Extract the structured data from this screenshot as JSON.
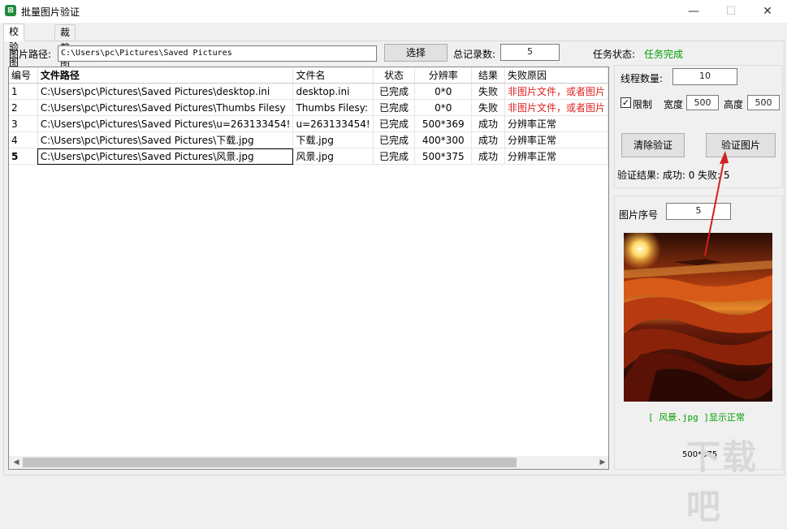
{
  "window": {
    "title": "批量图片验证",
    "minimize": "—",
    "maximize": "☐",
    "close": "✕"
  },
  "tabs": [
    {
      "label": "校验图片"
    },
    {
      "label": "裁剪图片"
    }
  ],
  "toolbar": {
    "path_label": "图片路径:",
    "path_value": "C:\\Users\\pc\\Pictures\\Saved Pictures",
    "select_button": "选择",
    "total_label": "总记录数:",
    "total_value": "5",
    "status_label": "任务状态:",
    "status_value": "任务完成"
  },
  "grid": {
    "columns": [
      "编号",
      "文件路径",
      "文件名",
      "状态",
      "分辨率",
      "结果",
      "失败原因"
    ],
    "rows": [
      [
        "1",
        "C:\\Users\\pc\\Pictures\\Saved Pictures\\desktop.ini",
        "desktop.ini",
        "已完成",
        "0*0",
        "失败",
        "非图片文件，或者图片"
      ],
      [
        "2",
        "C:\\Users\\pc\\Pictures\\Saved Pictures\\Thumbs Filesy",
        "Thumbs Filesy:",
        "已完成",
        "0*0",
        "失败",
        "非图片文件，或者图片"
      ],
      [
        "3",
        "C:\\Users\\pc\\Pictures\\Saved Pictures\\u=263133454!",
        "u=263133454!",
        "已完成",
        "500*369",
        "成功",
        "分辨率正常"
      ],
      [
        "4",
        "C:\\Users\\pc\\Pictures\\Saved Pictures\\下载.jpg",
        "下载.jpg",
        "已完成",
        "400*300",
        "成功",
        "分辨率正常"
      ],
      [
        "5",
        "C:\\Users\\pc\\Pictures\\Saved Pictures\\风景.jpg",
        "风景.jpg",
        "已完成",
        "500*375",
        "成功",
        "分辨率正常"
      ]
    ]
  },
  "settings": {
    "thread_label": "线程数量:",
    "thread_value": "10",
    "limit_label": "限制",
    "limit_checked": "✓",
    "width_label": "宽度",
    "width_value": "500",
    "height_label": "高度",
    "height_value": "500",
    "clear_button": "清除验证",
    "verify_button": "验证图片",
    "result_text": "验证结果: 成功: 0 失败: 5"
  },
  "preview": {
    "index_label": "图片序号",
    "index_value": "5",
    "caption": "[ 风景.jpg ]显示正常",
    "resolution": "500*375"
  },
  "watermark": "下载吧",
  "colors": {
    "success": "#00a000",
    "fail": "#e02020",
    "annotation_arrow": "#d02020"
  }
}
